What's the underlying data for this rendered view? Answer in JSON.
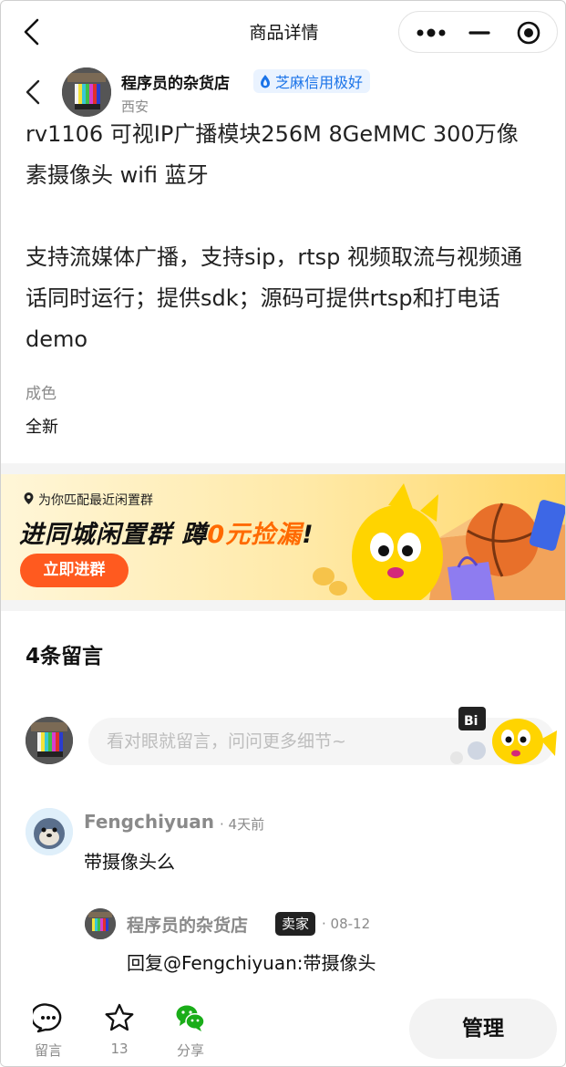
{
  "titlebar": {
    "title": "商品详情"
  },
  "seller": {
    "name": "程序员的杂货店",
    "credit": "芝麻信用极好",
    "location": "西安"
  },
  "product": {
    "title_line1": "rv1106 可视IP广播模块256M 8GeMMC 300万像",
    "title_line2": "素摄像头 wifi 蓝牙",
    "desc_line1": "支持流媒体广播，支持sip，rtsp 视频取流与视频通",
    "desc_line2": "话同时运行；提供sdk；源码可提供rtsp和打电话",
    "desc_line3": "demo",
    "condition_label": "成色",
    "condition_value": "全新"
  },
  "banner": {
    "subtitle": "为你匹配最近闲置群",
    "headline_a": "进同城闲置群 蹲",
    "headline_b": "0元捡漏",
    "headline_c": "!",
    "button": "立即进群"
  },
  "comments": {
    "title": "4条留言",
    "input_placeholder": "看对眼就留言，问问更多细节~",
    "items": [
      {
        "user": "Fengchiyuan",
        "time": "· 4天前",
        "text": "带摄像头么",
        "reply": {
          "user": "程序员的杂货店",
          "badge": "卖家",
          "time": "· 08-12",
          "text": "回复@Fengchiyuan:带摄像头"
        }
      }
    ]
  },
  "bottombar": {
    "comment_label": "留言",
    "fav_count": "13",
    "share_label": "分享",
    "manage_label": "管理"
  },
  "colors": {
    "accent_blue": "#1a73e8",
    "banner_orange": "#ff5a1f",
    "wechat_green": "#1aad19"
  },
  "icons": [
    "back-icon",
    "more-icon",
    "minimize-icon",
    "target-icon",
    "credit-drop-icon",
    "location-pin-icon",
    "comment-icon",
    "star-icon",
    "wechat-icon"
  ]
}
